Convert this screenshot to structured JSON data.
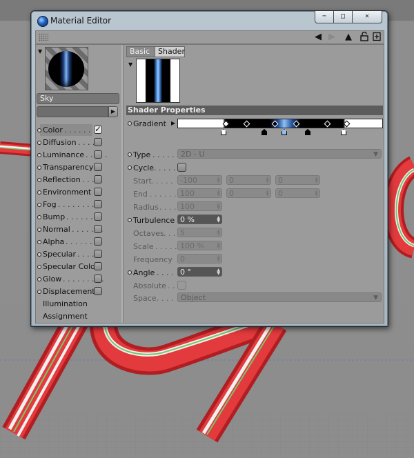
{
  "window": {
    "title": "Material Editor",
    "caption_min": "−",
    "caption_max": "□",
    "caption_close": "✕"
  },
  "toolbar": {
    "icons": [
      "back-arrow-icon",
      "forward-arrow-icon",
      "up-arrow-icon",
      "lock-icon",
      "new-window-icon"
    ]
  },
  "material": {
    "name": "Sky"
  },
  "channels": [
    {
      "label": "Color",
      "dots": ". . . . . . . .",
      "checked": true,
      "selected": true
    },
    {
      "label": "Diffusion",
      "dots": ". . . . .",
      "checked": false
    },
    {
      "label": "Luminance",
      "dots": ". . . . .",
      "checked": false
    },
    {
      "label": "Transparency",
      "dots": "",
      "checked": false
    },
    {
      "label": "Reflection",
      "dots": ". . . .",
      "checked": false
    },
    {
      "label": "Environment",
      "dots": "",
      "checked": false
    },
    {
      "label": "Fog",
      "dots": ". . . . . . . . .",
      "checked": false
    },
    {
      "label": "Bump",
      "dots": ". . . . . . . .",
      "checked": false
    },
    {
      "label": "Normal",
      "dots": ". . . . . . .",
      "checked": false
    },
    {
      "label": "Alpha",
      "dots": ". . . . . . . .",
      "checked": false
    },
    {
      "label": "Specular",
      "dots": ". . . . .",
      "checked": false
    },
    {
      "label": "Specular Color",
      "dots": "",
      "checked": false
    },
    {
      "label": "Glow",
      "dots": ". . . . . . . . .",
      "checked": false
    },
    {
      "label": "Displacement",
      "dots": "",
      "checked": false
    }
  ],
  "extra_items": [
    "Illumination",
    "Assignment"
  ],
  "tabs": {
    "basic": "Basic",
    "shader": "Shader"
  },
  "shader": {
    "section": "Shader Properties",
    "gradient_label": "Gradient",
    "type_label": "Type",
    "type_value": "2D - U",
    "cycle_label": "Cycle",
    "start_label": "Start",
    "start_values": [
      "-100",
      "0",
      "0"
    ],
    "end_label": "End",
    "end_values": [
      "100",
      "0",
      "0"
    ],
    "radius_label": "Radius",
    "radius_value": "100",
    "turbulence_label": "Turbulence",
    "turbulence_value": "0 %",
    "octaves_label": "Octaves",
    "octaves_value": "5",
    "scale_label": "Scale",
    "scale_value": "100 %",
    "frequency_label": "Frequency",
    "frequency_value": "0",
    "angle_label": "Angle",
    "angle_value": "0 °",
    "absolute_label": "Absolute",
    "space_label": "Space",
    "space_value": "Object"
  },
  "colors": {
    "viewport_bg": "#8a8a8a",
    "candy_red": "#d6252a",
    "candy_white": "#f2f2f2",
    "candy_green": "#5cbf4a"
  }
}
